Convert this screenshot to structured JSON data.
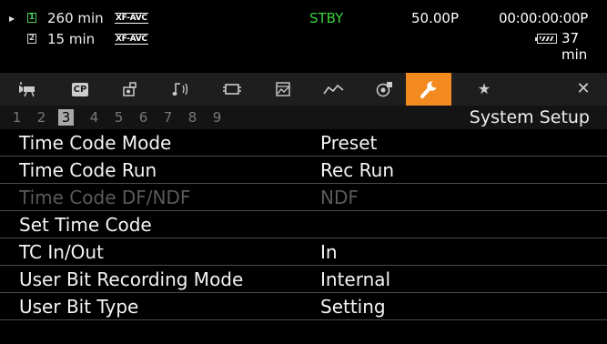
{
  "status": {
    "slot1": {
      "number": "1",
      "remaining": "260 min",
      "format": "XF-AVC"
    },
    "slot2": {
      "number": "2",
      "remaining": "15 min",
      "format": "XF-AVC"
    },
    "state": "STBY",
    "frame_rate": "50.00P",
    "timecode": "00:00:00:00P",
    "battery": "37 min",
    "colors": {
      "slot1": "#4ed35a",
      "state": "#39d23f"
    }
  },
  "tabs": [
    {
      "icon": "camera-icon",
      "active": false
    },
    {
      "icon": "custom-picture-icon",
      "label": "CP",
      "active": false
    },
    {
      "icon": "camera-setup-icon",
      "active": false
    },
    {
      "icon": "audio-icon",
      "active": false
    },
    {
      "icon": "recording-media-icon",
      "active": false
    },
    {
      "icon": "assistance-functions-icon",
      "active": false
    },
    {
      "icon": "network-icon",
      "active": false
    },
    {
      "icon": "recording-settings-icon",
      "active": false
    },
    {
      "icon": "wrench-icon",
      "active": true
    },
    {
      "icon": "star-icon",
      "active": false
    },
    {
      "icon": "close-icon",
      "active": false
    }
  ],
  "pages": {
    "numbers": [
      "1",
      "2",
      "3",
      "4",
      "5",
      "6",
      "7",
      "8",
      "9"
    ],
    "current": "3",
    "title": "System Setup"
  },
  "menu": {
    "items": [
      {
        "label": "Time Code Mode",
        "value": "Preset",
        "enabled": true
      },
      {
        "label": "Time Code Run",
        "value": "Rec Run",
        "enabled": true
      },
      {
        "label": "Time Code DF/NDF",
        "value": "NDF",
        "enabled": false
      },
      {
        "label": "Set Time Code",
        "value": "",
        "enabled": true
      },
      {
        "label": "TC In/Out",
        "value": "In",
        "enabled": true
      },
      {
        "label": "User Bit Recording Mode",
        "value": "Internal",
        "enabled": true
      },
      {
        "label": "User Bit Type",
        "value": "Setting",
        "enabled": true
      }
    ]
  },
  "theme": {
    "accent": "#f28a1f",
    "disabled_text": "#5a5a5a"
  }
}
